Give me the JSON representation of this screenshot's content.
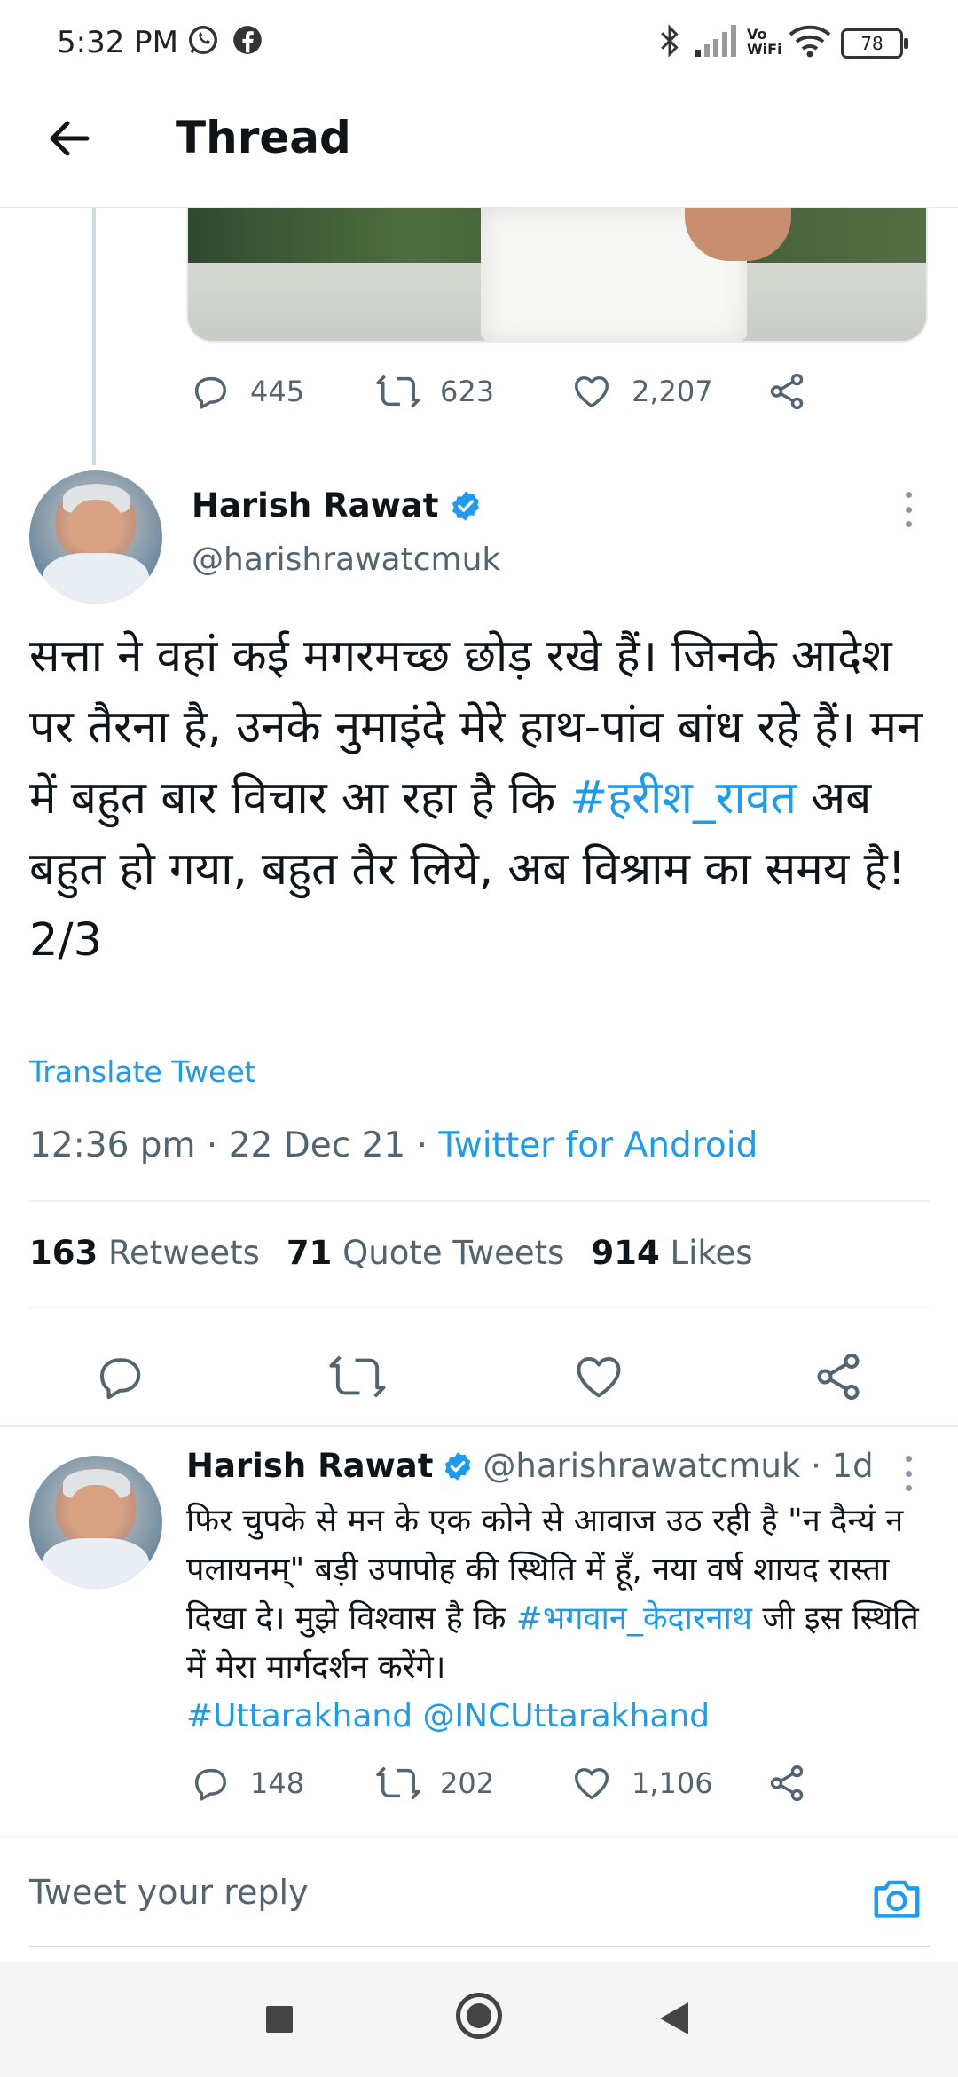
{
  "status_bar": {
    "time": "5:32 PM",
    "vowifi": "Vo WiFi",
    "battery": "78"
  },
  "header": {
    "title": "Thread"
  },
  "prev_tweet": {
    "replies": "445",
    "retweets": "623",
    "likes": "2,207"
  },
  "main_tweet": {
    "name": "Harish Rawat",
    "handle": "@harishrawatcmuk",
    "text_part1": "सत्ता ने वहां कई मगरमच्छ छोड़ रखे हैं। जिनके आदेश पर तैरना है, उनके नुमाइंदे मेरे हाथ-पांव बांध रहे हैं। मन में बहुत बार विचार आ रहा है कि ",
    "hashtag": "#हरीश_रावत",
    "text_part2": " अब बहुत हो गया, बहुत तैर लिये, अब विश्राम का समय है!",
    "count_line": "2/3",
    "translate": "Translate Tweet",
    "time": "12:36 pm · 22 Dec 21 · ",
    "source": "Twitter for Android",
    "retweets_count": "163",
    "retweets_label": " Retweets",
    "quotes_count": "71",
    "quotes_label": " Quote Tweets",
    "likes_count": "914",
    "likes_label": " Likes"
  },
  "reply_tweet": {
    "name": "Harish Rawat",
    "handle_time": "@harishrawatcmuk · 1d",
    "text_part1": "फिर चुपके से मन के एक कोने से आवाज उठ रही है \"न दैन्यं न पलायनम्\" बड़ी उपापोह की स्थिति में हूँ, नया वर्ष शायद रास्ता दिखा दे। मुझे विश्वास है कि ",
    "hashtag1": "#भगवान_केदारनाथ",
    "text_part2": " जी इस स्थिति में मेरा मार्गदर्शन करेंगे।",
    "hashtag2": "#Uttarakhand",
    "mention": "@INCUttarakhand",
    "replies": "148",
    "retweets": "202",
    "likes": "1,106"
  },
  "composer": {
    "placeholder": "Tweet your reply"
  },
  "colors": {
    "accent": "#1d9bf0",
    "secondary_text": "#536471",
    "primary_text": "#0f1419"
  }
}
